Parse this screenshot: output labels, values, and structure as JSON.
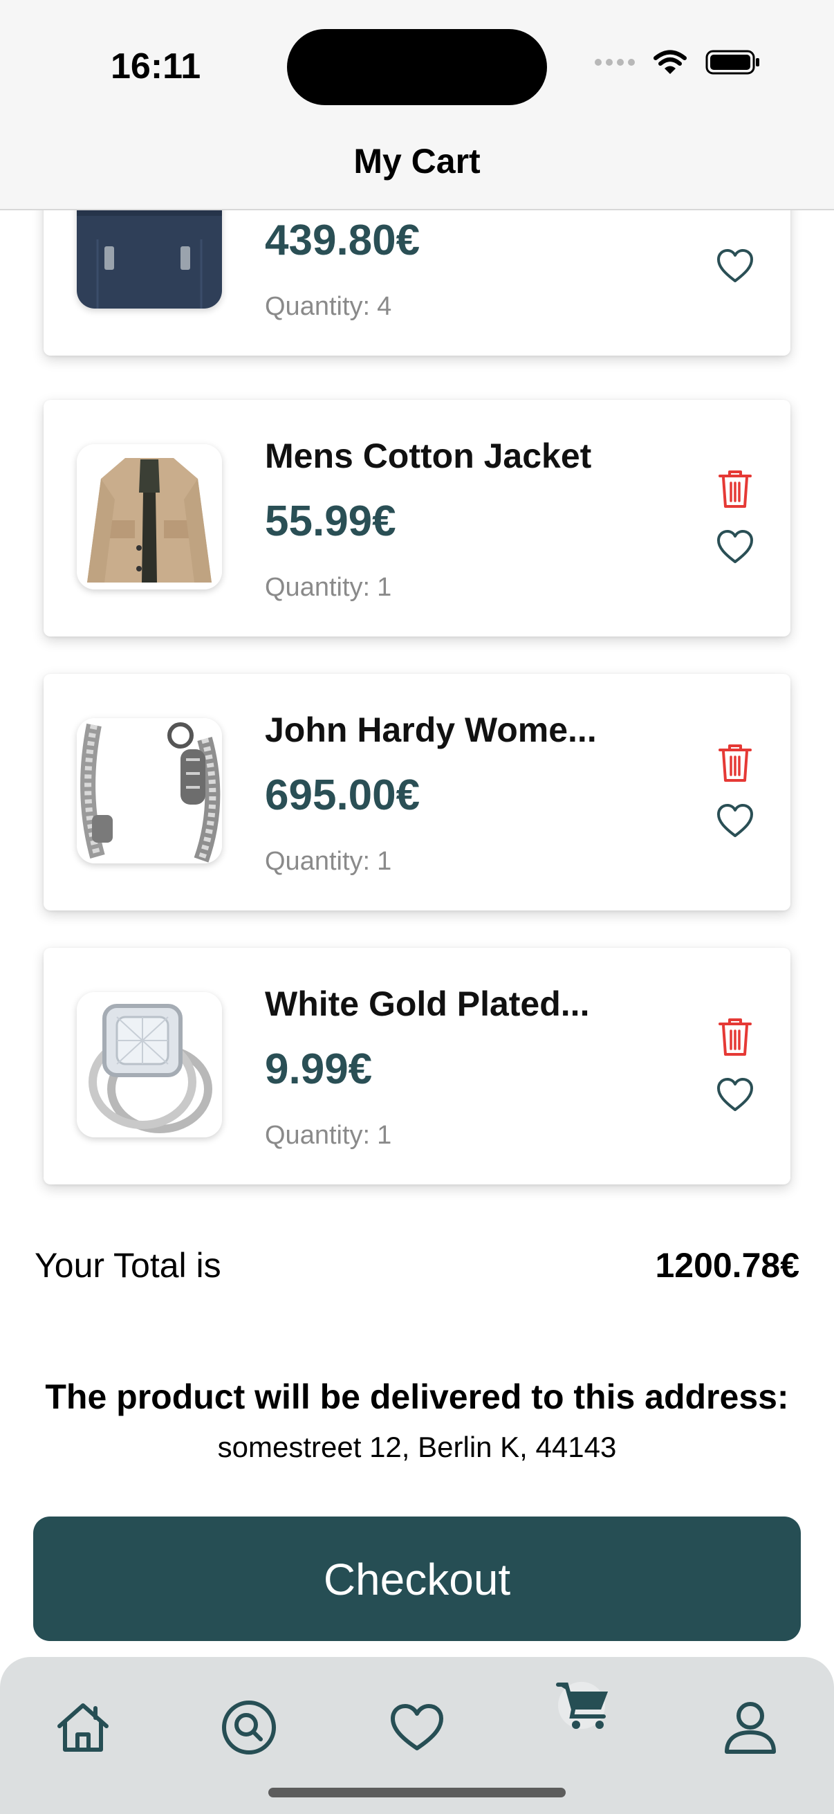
{
  "status_bar": {
    "time": "16:11"
  },
  "nav": {
    "title": "My Cart"
  },
  "cart": {
    "partial_item": {
      "price": "439.80€",
      "quantity_label": "Quantity:",
      "quantity": "4"
    },
    "items": [
      {
        "name": "Mens Cotton Jacket",
        "price": "55.99€",
        "quantity_label": "Quantity:",
        "quantity": "1"
      },
      {
        "name": "John Hardy Wome...",
        "price": "695.00€",
        "quantity_label": "Quantity:",
        "quantity": "1"
      },
      {
        "name": "White Gold Plated...",
        "price": "9.99€",
        "quantity_label": "Quantity:",
        "quantity": "1"
      }
    ]
  },
  "summary": {
    "total_label": "Your Total is",
    "total_value": "1200.78€",
    "delivery_title": "The product will be delivered to this address:",
    "address": "somestreet 12, Berlin K, 44143"
  },
  "checkout_label": "Checkout",
  "tabbar": {
    "items": [
      {
        "icon": "home-icon"
      },
      {
        "icon": "search-icon"
      },
      {
        "icon": "heart-icon"
      },
      {
        "icon": "cart-icon",
        "active": true
      },
      {
        "icon": "profile-icon"
      }
    ]
  },
  "colors": {
    "accent": "#264e54",
    "price": "#2a4f55",
    "delete": "#e53935",
    "tabbar_bg": "#dcdfe0"
  }
}
